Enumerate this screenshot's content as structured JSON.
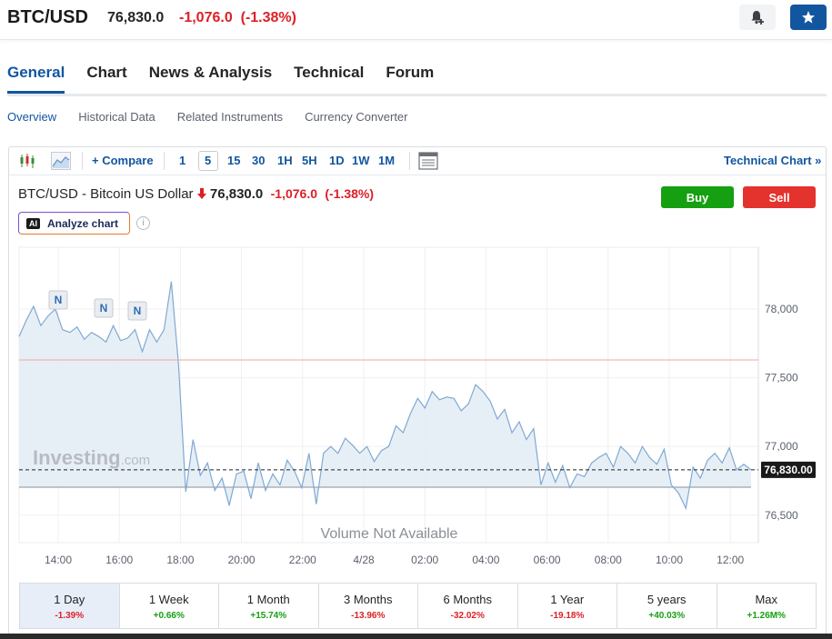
{
  "header": {
    "symbol": "BTC/USD",
    "price": "76,830.0",
    "change": "-1,076.0",
    "change_pct": "(-1.38%)"
  },
  "tabs": [
    {
      "label": "General",
      "active": true
    },
    {
      "label": "Chart",
      "active": false
    },
    {
      "label": "News & Analysis",
      "active": false
    },
    {
      "label": "Technical",
      "active": false
    },
    {
      "label": "Forum",
      "active": false
    }
  ],
  "subnav": [
    {
      "label": "Overview",
      "active": true
    },
    {
      "label": "Historical Data",
      "active": false
    },
    {
      "label": "Related Instruments",
      "active": false
    },
    {
      "label": "Currency Converter",
      "active": false
    }
  ],
  "toolbar": {
    "compare_label": "+ Compare",
    "timeframes": [
      "1",
      "5",
      "15",
      "30",
      "1H",
      "5H",
      "1D",
      "1W",
      "1M"
    ],
    "active_timeframe": "5",
    "technical_chart_label": "Technical Chart »"
  },
  "instrument": {
    "title": "BTC/USD - Bitcoin US Dollar",
    "price": "76,830.0",
    "change": "-1,076.0",
    "change_pct": "(-1.38%)",
    "buy_label": "Buy",
    "sell_label": "Sell",
    "analyze_label": "Analyze chart",
    "ai_badge": "AI",
    "info_icon": "i"
  },
  "chart_data": {
    "type": "area",
    "x_ticks": [
      "14:00",
      "16:00",
      "18:00",
      "20:00",
      "22:00",
      "4/28",
      "02:00",
      "04:00",
      "06:00",
      "08:00",
      "10:00",
      "12:00"
    ],
    "y_ticks": [
      "78,000",
      "77,500",
      "77,000",
      "76,500"
    ],
    "ylim": [
      76300,
      78450
    ],
    "current_label": "76,830.00",
    "current_value": 76830,
    "prev_close": 77630,
    "watermark": "Investing.com",
    "volume_note": "Volume Not Available",
    "news_markers": [
      "N",
      "N",
      "N"
    ],
    "series": [
      {
        "values": [
          77800,
          77920,
          78020,
          77880,
          77950,
          78000,
          77850,
          77830,
          77870,
          77780,
          77830,
          77800,
          77760,
          77880,
          77770,
          77790,
          77850,
          77690,
          77850,
          77760,
          77850,
          78200,
          77600,
          76670,
          77050,
          76790,
          76880,
          76680,
          76770,
          76570,
          76800,
          76820,
          76620,
          76880,
          76680,
          76800,
          76720,
          76900,
          76820,
          76700,
          76950,
          76580,
          76950,
          77000,
          76950,
          77060,
          77010,
          76950,
          77000,
          76890,
          76970,
          77000,
          77150,
          77100,
          77240,
          77350,
          77280,
          77400,
          77340,
          77360,
          77350,
          77260,
          77310,
          77450,
          77400,
          77330,
          77200,
          77270,
          77100,
          77180,
          77050,
          77130,
          76720,
          76880,
          76740,
          76860,
          76700,
          76800,
          76780,
          76880,
          76920,
          76950,
          76850,
          77000,
          76950,
          76880,
          77000,
          76920,
          76870,
          76980,
          76720,
          76660,
          76550,
          76850,
          76770,
          76900,
          76950,
          76880,
          76990,
          76830,
          76870,
          76830
        ]
      }
    ]
  },
  "periods": [
    {
      "label": "1 Day",
      "value": "-1.39%",
      "dir": "neg",
      "active": true
    },
    {
      "label": "1 Week",
      "value": "+0.66%",
      "dir": "pos",
      "active": false
    },
    {
      "label": "1 Month",
      "value": "+15.74%",
      "dir": "pos",
      "active": false
    },
    {
      "label": "3 Months",
      "value": "-13.96%",
      "dir": "neg",
      "active": false
    },
    {
      "label": "6 Months",
      "value": "-32.02%",
      "dir": "neg",
      "active": false
    },
    {
      "label": "1 Year",
      "value": "-19.18%",
      "dir": "neg",
      "active": false
    },
    {
      "label": "5 years",
      "value": "+40.03%",
      "dir": "pos",
      "active": false
    },
    {
      "label": "Max",
      "value": "+1.26M%",
      "dir": "pos",
      "active": false
    }
  ],
  "colors": {
    "accent": "#1256a0",
    "down": "#dc1f26",
    "up": "#15a011",
    "line": "#7fa9d3",
    "fill": "#e3ecf5"
  }
}
